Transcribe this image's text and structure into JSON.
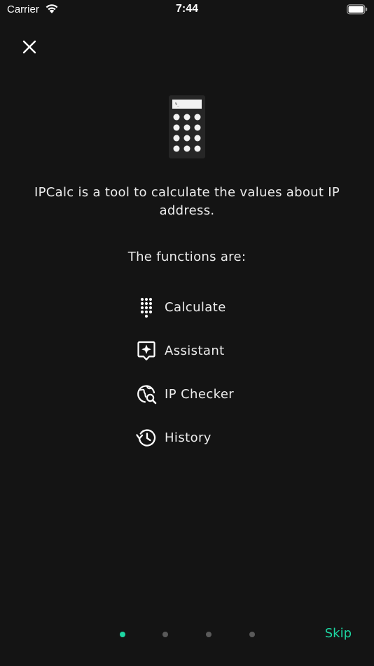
{
  "status_bar": {
    "carrier": "Carrier",
    "time": "7:44"
  },
  "onboarding": {
    "close_icon": "close-icon",
    "hero_icon": "calculator-icon",
    "intro_text": "IPCalc is a tool to calculate the values about IP address.",
    "functions_title": "The functions are:",
    "features": [
      {
        "label": "Calculate",
        "icon": "dialpad-icon"
      },
      {
        "label": "Assistant",
        "icon": "assistant-icon"
      },
      {
        "label": "IP Checker",
        "icon": "globe-search-icon"
      },
      {
        "label": "History",
        "icon": "history-icon"
      }
    ],
    "pagination": {
      "page_count": 4,
      "current_page": 1
    },
    "skip_label": "Skip"
  },
  "colors": {
    "background": "#141414",
    "text": "#ececec",
    "accent": "#1dd6a2",
    "dot_inactive": "#5a5a5a"
  }
}
